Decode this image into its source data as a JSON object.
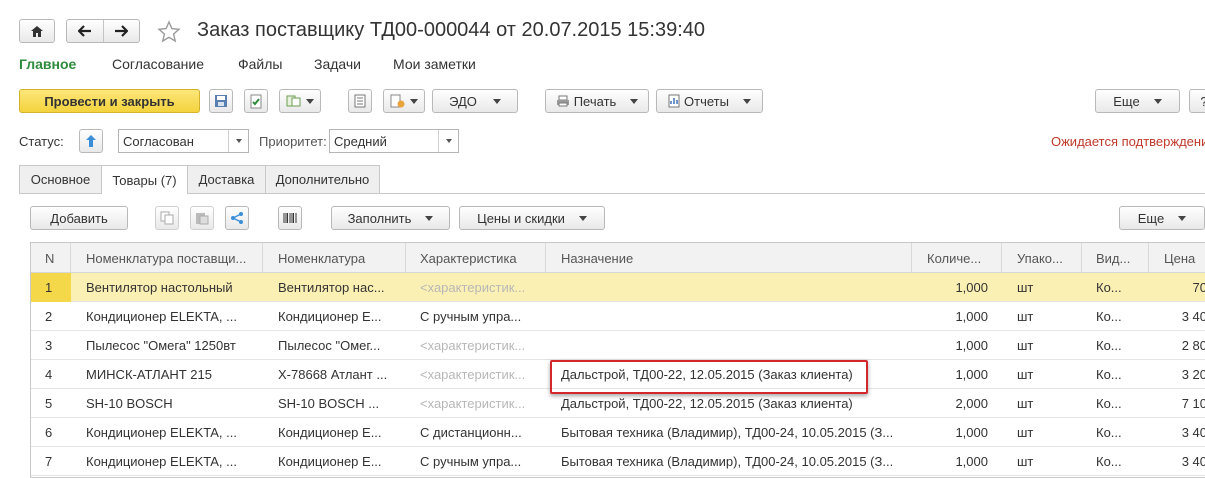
{
  "window": {
    "title": "Заказ поставщику ТД00-000044 от 20.07.2015 15:39:40"
  },
  "nav": {
    "home_icon": "home-icon",
    "back_icon": "arrow-left-icon",
    "forward_icon": "arrow-right-icon",
    "star_icon": "star-icon"
  },
  "sections": [
    {
      "label": "Главное"
    },
    {
      "label": "Согласование"
    },
    {
      "label": "Файлы"
    },
    {
      "label": "Задачи"
    },
    {
      "label": "Мои заметки"
    }
  ],
  "toolbar": {
    "post_close": "Провести и закрыть",
    "edo": "ЭДО",
    "print": "Печать",
    "reports": "Отчеты",
    "more": "Еще",
    "help": "?"
  },
  "status": {
    "label": "Статус:",
    "value": "Согласован",
    "priority_label": "Приоритет:",
    "priority_value": "Средний",
    "warning": "Ожидается подтверждени"
  },
  "tabs": [
    {
      "label": "Основное"
    },
    {
      "label": "Товары (7)"
    },
    {
      "label": "Доставка"
    },
    {
      "label": "Дополнительно"
    }
  ],
  "table_toolbar": {
    "add": "Добавить",
    "fill": "Заполнить",
    "prices": "Цены и скидки",
    "more": "Еще"
  },
  "columns": [
    "N",
    "Номенклатура поставщи...",
    "Номенклатура",
    "Характеристика",
    "Назначение",
    "Количе...",
    "Упако...",
    "Вид...",
    "Цена"
  ],
  "rows": [
    {
      "n": "1",
      "supplier_item": "Вентилятор настольный",
      "item": "Вентилятор нас...",
      "characteristic": "<характеристик...",
      "purpose": "",
      "qty": "1,000",
      "pack": "шт",
      "kind": "Ко...",
      "price": "70"
    },
    {
      "n": "2",
      "supplier_item": "Кондиционер ELEKTA, ...",
      "item": "Кондиционер E...",
      "characteristic": "С ручным упра...",
      "purpose": "",
      "qty": "1,000",
      "pack": "шт",
      "kind": "Ко...",
      "price": "3 40"
    },
    {
      "n": "3",
      "supplier_item": "Пылесос \"Омега\" 1250вт",
      "item": "Пылесос \"Омег...",
      "characteristic": "<характеристик...",
      "purpose": "",
      "qty": "1,000",
      "pack": "шт",
      "kind": "Ко...",
      "price": "2 80"
    },
    {
      "n": "4",
      "supplier_item": "МИНСК-АТЛАНТ 215",
      "item": "X-78668 Атлант ...",
      "characteristic": "<характеристик...",
      "purpose": "Дальстрой, ТД00-22, 12.05.2015 (Заказ клиента)",
      "qty": "1,000",
      "pack": "шт",
      "kind": "Ко...",
      "price": "3 20"
    },
    {
      "n": "5",
      "supplier_item": "SH-10 BOSCH",
      "item": "SH-10 BOSCH ...",
      "characteristic": "<характеристик...",
      "purpose": "Дальстрой, ТД00-22, 12.05.2015 (Заказ клиента)",
      "qty": "2,000",
      "pack": "шт",
      "kind": "Ко...",
      "price": "7 10"
    },
    {
      "n": "6",
      "supplier_item": "Кондиционер ELEKTA, ...",
      "item": "Кондиционер E...",
      "characteristic": "С дистанционн...",
      "purpose": "Бытовая техника (Владимир), ТД00-24, 10.05.2015 (З...",
      "qty": "1,000",
      "pack": "шт",
      "kind": "Ко...",
      "price": "3 40"
    },
    {
      "n": "7",
      "supplier_item": "Кондиционер ELEKTA, ...",
      "item": "Кондиционер E...",
      "characteristic": "С ручным упра...",
      "purpose": "Бытовая техника (Владимир), ТД00-24, 10.05.2015 (З...",
      "qty": "1,000",
      "pack": "шт",
      "kind": "Ко...",
      "price": "3 40"
    }
  ],
  "colors": {
    "accent_green": "#2e8b3d",
    "primary_button": "#f5d84a",
    "selected_row": "#fbf0b4",
    "highlight_border": "#d4272c",
    "warning_text": "#c0392b"
  }
}
